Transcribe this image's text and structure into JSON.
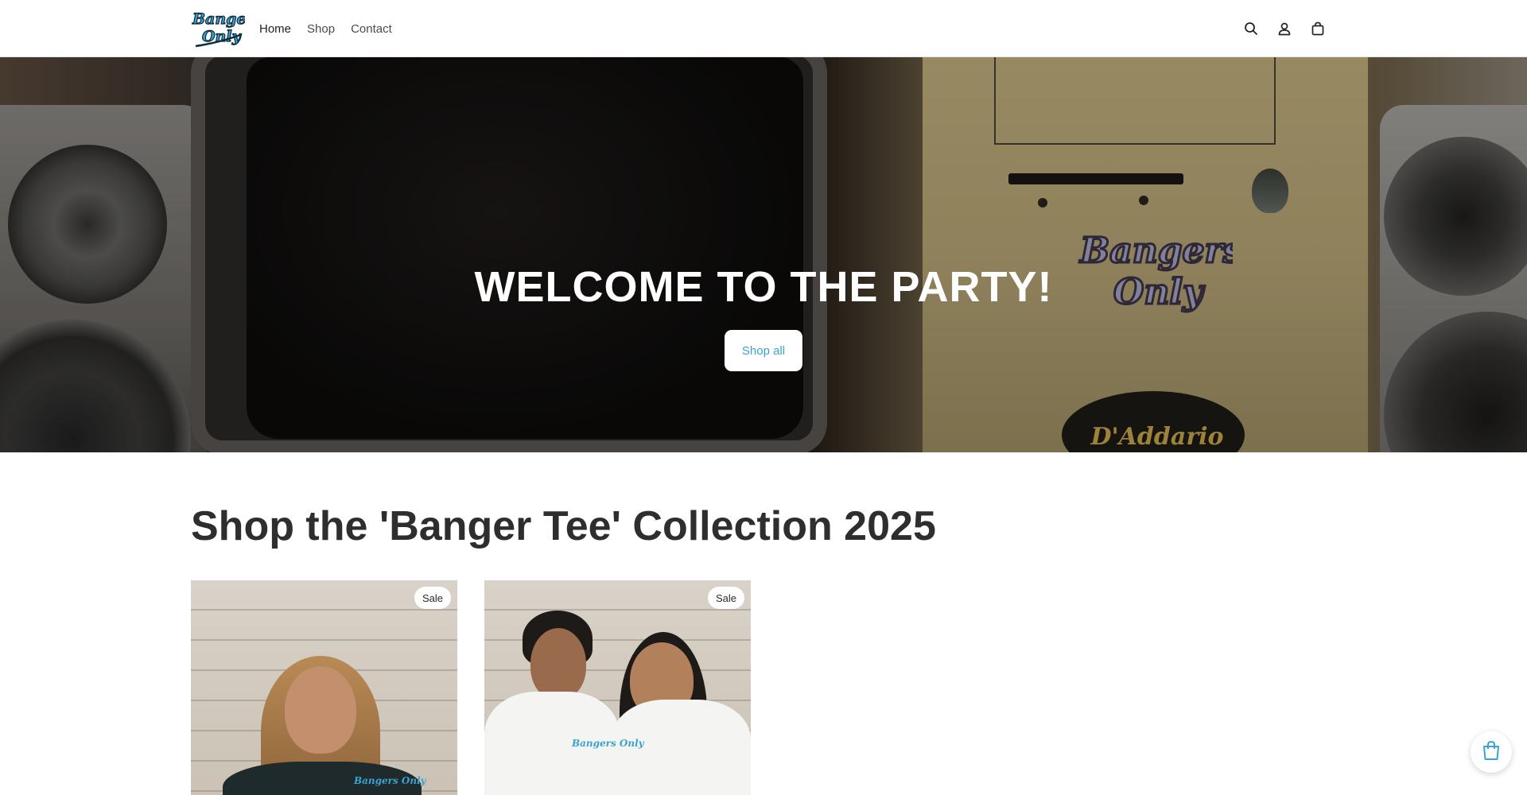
{
  "brand": {
    "logo_text_line1": "Bangers",
    "logo_text_line2": "Only",
    "accent": "#3aa3d1"
  },
  "nav": {
    "items": [
      {
        "label": "Home",
        "active": true
      },
      {
        "label": "Shop",
        "active": false
      },
      {
        "label": "Contact",
        "active": false
      }
    ]
  },
  "header_icons": [
    "search-icon",
    "account-icon",
    "cart-icon"
  ],
  "hero": {
    "title": "WELCOME TO THE PARTY!",
    "button_label": "Shop all",
    "sticker_line1": "Bangers",
    "sticker_line2": "Only",
    "badge_text": "D'Addario"
  },
  "collection": {
    "title": "Shop the 'Banger Tee' Collection 2025",
    "products": [
      {
        "badge": "Sale",
        "tee_logo": "Bangers Only"
      },
      {
        "badge": "Sale",
        "tee_logo": "Bangers Only"
      }
    ]
  },
  "floating_cart": {
    "icon": "shopping-bag-icon"
  }
}
